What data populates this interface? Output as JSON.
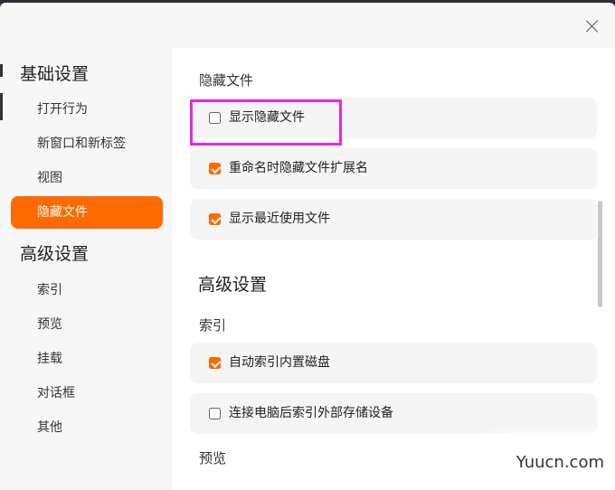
{
  "sidebar": {
    "basic_title": "基础设置",
    "basic_items": [
      "打开行为",
      "新窗口和新标签",
      "视图",
      "隐藏文件"
    ],
    "advanced_title": "高级设置",
    "advanced_items": [
      "索引",
      "预览",
      "挂载",
      "对话框",
      "其他"
    ],
    "active_item": "隐藏文件"
  },
  "content": {
    "hidden_section_title": "隐藏文件",
    "hidden_options": [
      {
        "label": "显示隐藏文件",
        "checked": false
      },
      {
        "label": "重命名时隐藏文件扩展名",
        "checked": true
      },
      {
        "label": "显示最近使用文件",
        "checked": true
      }
    ],
    "advanced_title": "高级设置",
    "index_title": "索引",
    "index_options": [
      {
        "label": "自动索引内置磁盘",
        "checked": true
      },
      {
        "label": "连接电脑后索引外部存储设备",
        "checked": false
      }
    ],
    "preview_title": "预览"
  },
  "watermark": "Yuucn.com",
  "colors": {
    "accent": "#ff6a00",
    "highlight": "#e626e6"
  }
}
